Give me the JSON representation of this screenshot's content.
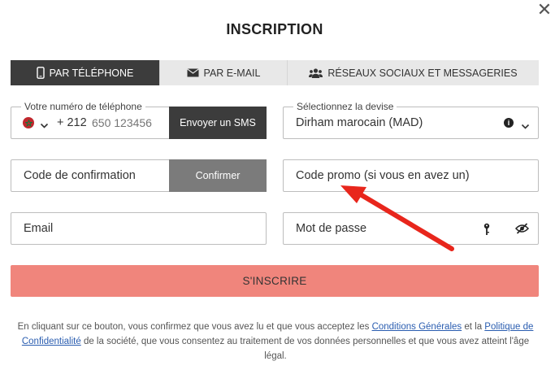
{
  "modal": {
    "title": "INSCRIPTION",
    "close_glyph": "✕"
  },
  "tabs": [
    {
      "label": "PAR TÉLÉPHONE",
      "icon": "phone-icon",
      "active": true
    },
    {
      "label": "PAR E-MAIL",
      "icon": "envelope-icon",
      "active": false
    },
    {
      "label": "RÉSEAUX SOCIAUX ET MESSAGERIES",
      "icon": "users-icon",
      "active": false
    }
  ],
  "phone": {
    "legend": "Votre numéro de téléphone",
    "country_flag": "morocco-flag-icon",
    "dial_code": "+ 212",
    "placeholder": "650 123456",
    "send_sms_label": "Envoyer un SMS"
  },
  "currency": {
    "legend": "Sélectionnez la devise",
    "value": "Dirham marocain (MAD)"
  },
  "confirmation": {
    "placeholder": "Code de confirmation",
    "confirm_label": "Confirmer"
  },
  "promo": {
    "placeholder": "Code promo (si vous en avez un)"
  },
  "email": {
    "placeholder": "Email"
  },
  "password": {
    "placeholder": "Mot de passe"
  },
  "submit_label": "S'INSCRIRE",
  "legal": {
    "part1": "En cliquant sur ce bouton, vous confirmez que vous avez lu et que vous acceptez les ",
    "link1": "Conditions Générales",
    "part2": " et la ",
    "link2": "Politique de Confidentialité",
    "part3": " de la société, que vous consentez au traitement de vos données personnelles et que vous avez atteint l'âge légal."
  },
  "colors": {
    "dark": "#3c3c3c",
    "submit": "#f0857c",
    "link": "#2a5db0",
    "annotation_arrow": "#e8261c"
  }
}
